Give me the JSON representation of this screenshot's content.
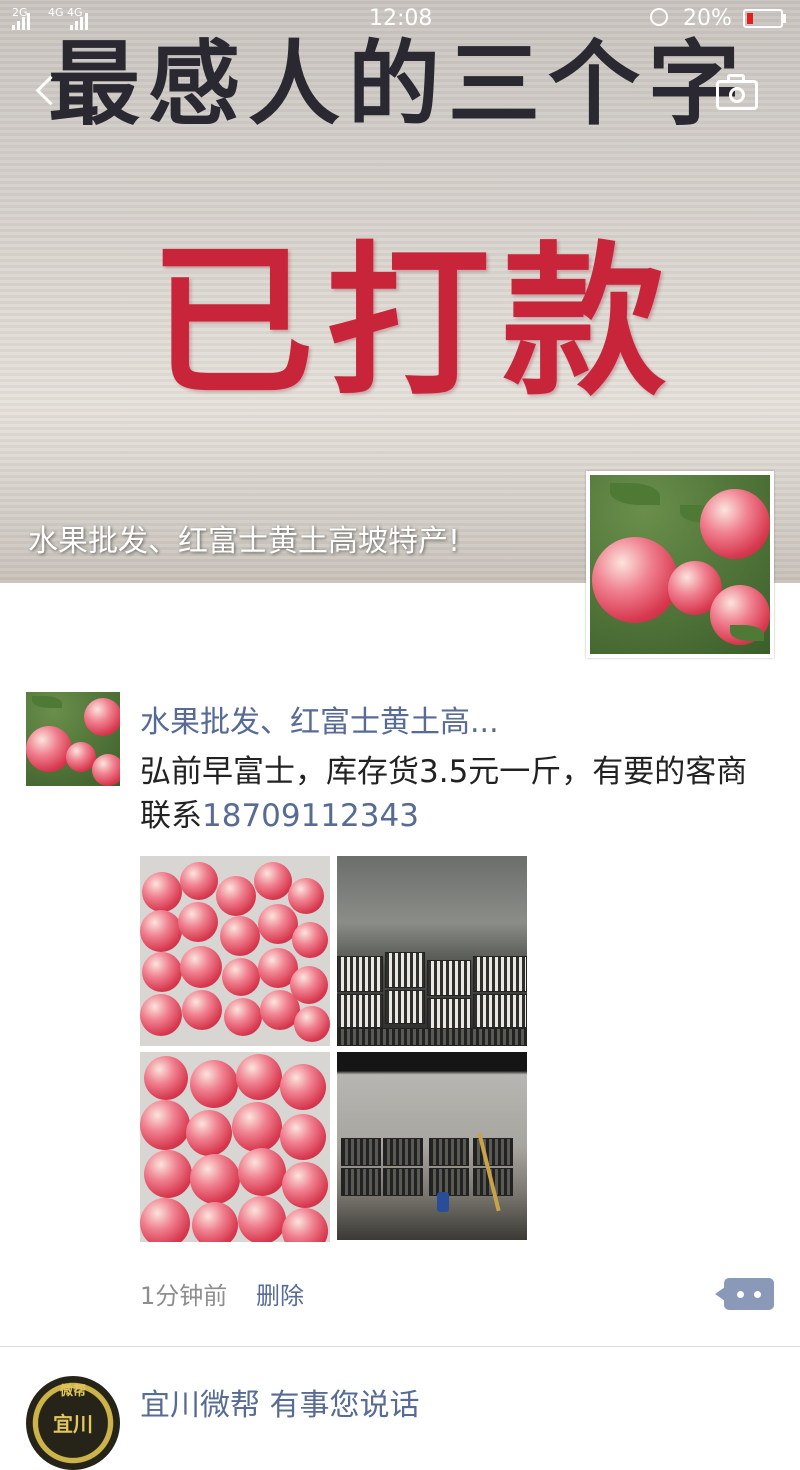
{
  "status_bar": {
    "signal1_label": "2G",
    "signal2_label": "4G 4G",
    "time": "12:08",
    "battery_text": "20%",
    "battery_level": 0.2,
    "battery_color": "#e02020"
  },
  "cover": {
    "top_text": "最感人的三个字",
    "big_text": "已打款",
    "profile_name": "水果批发、红富士黄土高坡特产!"
  },
  "header": {
    "back_icon": "chevron-left-icon",
    "camera_icon": "camera-icon"
  },
  "post": {
    "author": "水果批发、红富士黄土高...",
    "content": "弘前早富士，库存货3.5元一斤，有要的客商联系",
    "phone": "18709112343",
    "images": [
      "apples-box-photo",
      "crates-warehouse-photo",
      "apples-box-photo-2",
      "crates-warehouse-photo-2"
    ],
    "time": "1分钟前",
    "delete_label": "删除",
    "comment_icon": "comment-dots-icon"
  },
  "next_post": {
    "avatar_label": "微帮",
    "avatar_text": "宜川",
    "author": "宜川微帮 有事您说话"
  },
  "colors": {
    "link": "#576b95",
    "accent_red": "#c8243a"
  }
}
